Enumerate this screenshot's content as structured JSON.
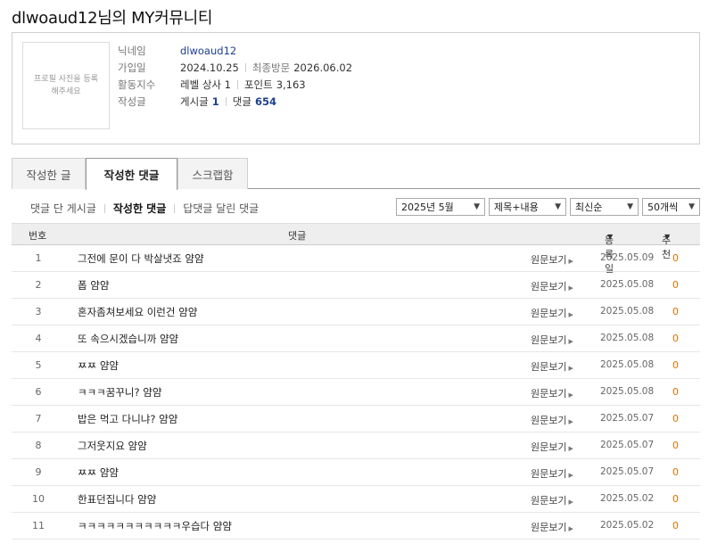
{
  "page_title": "dlwoaud12님의 MY커뮤니티",
  "profile": {
    "photo_text": "프로필 사진을 등록해주세요",
    "labels": {
      "nickname": "닉네임",
      "joined": "가입일",
      "activity": "활동지수",
      "written": "작성글"
    },
    "nickname": "dlwoaud12",
    "joined": "2024.10.25",
    "last_visit_label": "최종방문",
    "last_visit": "2026.06.02",
    "level": "레벨 상사 1",
    "points_label": "포인트",
    "points": "3,163",
    "posts_label": "게시글",
    "posts": "1",
    "comments_label": "댓글",
    "comments": "654"
  },
  "tabs": [
    {
      "label": "작성한 글",
      "active": false
    },
    {
      "label": "작성한 댓글",
      "active": true
    },
    {
      "label": "스크랩함",
      "active": false
    }
  ],
  "subnav": [
    {
      "label": "댓글 단 게시글",
      "active": false
    },
    {
      "label": "작성한 댓글",
      "active": true
    },
    {
      "label": "답댓글 달린 댓글",
      "active": false
    }
  ],
  "filters": {
    "month": "2025년 5월",
    "search_scope": "제목+내용",
    "sort": "최신순",
    "per_page": "50개씩"
  },
  "table": {
    "headers": {
      "num": "번호",
      "comment": "댓글",
      "date": "등록일",
      "recommend": "추천"
    },
    "view_label": "원문보기",
    "rows": [
      {
        "num": "1",
        "text": "그전에 문이 다 박살냇죠 얌얌",
        "date": "2025.05.09",
        "rec": "0"
      },
      {
        "num": "2",
        "text": "폽 얌얌",
        "date": "2025.05.08",
        "rec": "0"
      },
      {
        "num": "3",
        "text": "혼자좀쳐보세요 이런건 얌얌",
        "date": "2025.05.08",
        "rec": "0"
      },
      {
        "num": "4",
        "text": "또 속으시겠습니까 얌얌",
        "date": "2025.05.08",
        "rec": "0"
      },
      {
        "num": "5",
        "text": "ㅉㅉ 얌얌",
        "date": "2025.05.08",
        "rec": "0"
      },
      {
        "num": "6",
        "text": "ㅋㅋㅋ꿈꾸니? 얌얌",
        "date": "2025.05.08",
        "rec": "0"
      },
      {
        "num": "7",
        "text": "밥은 먹고 다니냐? 얌얌",
        "date": "2025.05.07",
        "rec": "0"
      },
      {
        "num": "8",
        "text": "그저웃지요 얌얌",
        "date": "2025.05.07",
        "rec": "0"
      },
      {
        "num": "9",
        "text": "ㅉㅉ 얌얌",
        "date": "2025.05.07",
        "rec": "0"
      },
      {
        "num": "10",
        "text": "한표던집니다 얌얌",
        "date": "2025.05.02",
        "rec": "0"
      },
      {
        "num": "11",
        "text": "ㅋㅋㅋㅋㅋㅋㅋㅋㅋㅋㅋ우습다 얌얌",
        "date": "2025.05.02",
        "rec": "0"
      }
    ]
  }
}
